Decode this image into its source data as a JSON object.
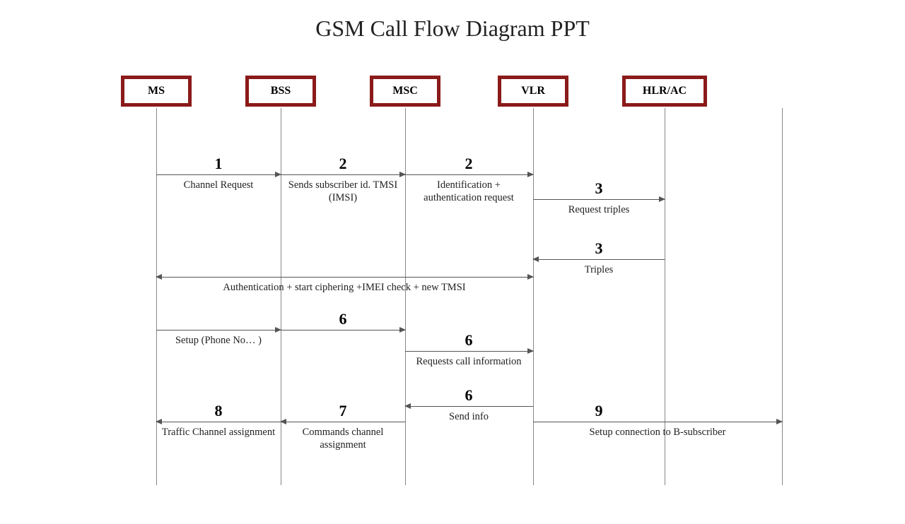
{
  "title": "GSM Call Flow Diagram PPT",
  "actors": {
    "ms": "MS",
    "bss": "BSS",
    "msc": "MSC",
    "vlr": "VLR",
    "hlrac": "HLR/AC"
  },
  "messages": {
    "m1_num": "1",
    "m1_label": "Channel Request",
    "m2a_num": "2",
    "m2a_label": "Sends subscriber id. TMSI (IMSI)",
    "m2b_num": "2",
    "m2b_label": "Identification + authentication request",
    "m3a_num": "3",
    "m3a_label": "Request triples",
    "m3b_num": "3",
    "m3b_label": "Triples",
    "m4_label": "Authentication + start ciphering +IMEI check + new TMSI",
    "m5_label": "Setup (Phone No… )",
    "m6a_num": "6",
    "m6b_num": "6",
    "m6b_label": "Requests call information",
    "m6c_num": "6",
    "m6c_label": "Send info",
    "m7_num": "7",
    "m7_label": "Commands channel assignment",
    "m8_num": "8",
    "m8_label": "Traffic Channel assignment",
    "m9_num": "9",
    "m9_label": "Setup connection  to B-subscriber"
  }
}
